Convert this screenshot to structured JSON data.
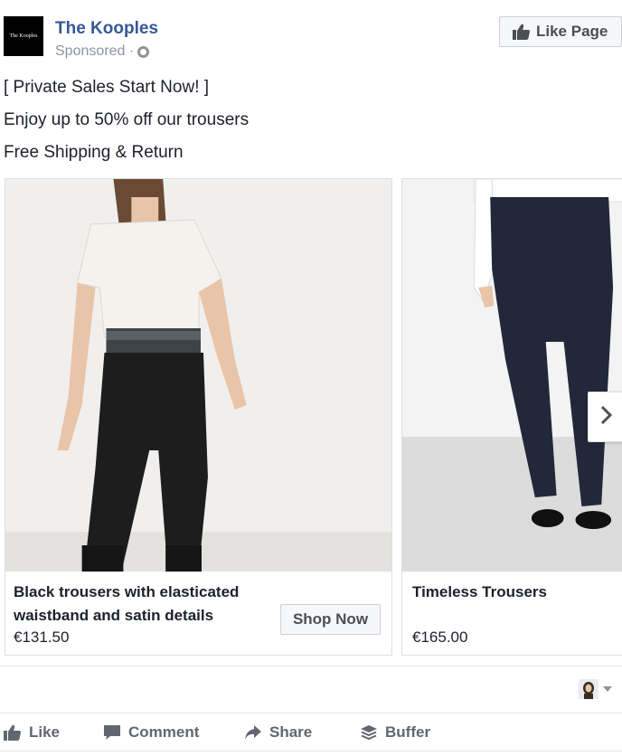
{
  "header": {
    "logo_text": "The Kooples",
    "page_name": "The Kooples",
    "sponsored": "Sponsored · ",
    "like_page_label": "Like Page"
  },
  "post": {
    "lines": [
      "[ Private Sales Start Now! ]",
      "Enjoy up to 50% off our trousers",
      "Free Shipping & Return"
    ]
  },
  "carousel": {
    "cards": [
      {
        "title": "Black trousers with elasticated waistband and satin details",
        "price": "€131.50",
        "cta": "Shop Now"
      },
      {
        "title": "Timeless Trousers",
        "price": "€165.00"
      }
    ]
  },
  "actions": {
    "like": "Like",
    "comment": "Comment",
    "share": "Share",
    "buffer": "Buffer"
  },
  "colors": {
    "link": "#365899",
    "muted": "#90949c",
    "action": "#616770"
  }
}
